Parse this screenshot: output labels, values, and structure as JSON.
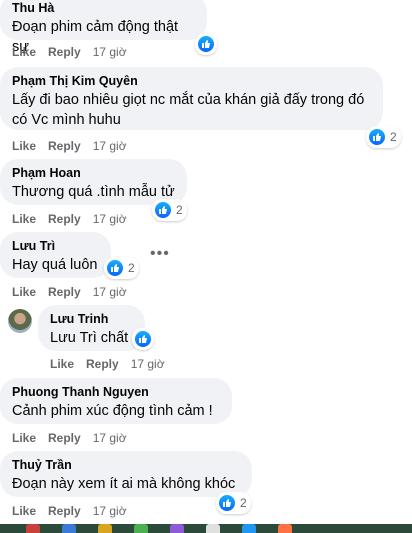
{
  "comments": [
    {
      "author": "Thu Hà",
      "text": "Đoạn phim cảm động thật sự",
      "reactions": ""
    },
    {
      "author": "Phạm Thị Kim Quyên",
      "text": "Lấy đi bao nhiêu giọt nc mắt của khán giả đấy trong đó có Vc mình huhu",
      "reactions": "2"
    },
    {
      "author": "Phạm Hoan",
      "text": "Thương quá .tình mẫu tử",
      "reactions": "2"
    },
    {
      "author": "Lưu Trì",
      "text": "Hay quá luôn",
      "reactions": "2"
    },
    {
      "author": "Lưu Trinh",
      "text": "Lưu Trì chất",
      "reactions": ""
    },
    {
      "author": "Phuong Thanh Nguyen",
      "text": "Cảnh phim xúc động tình cảm !",
      "reactions": ""
    },
    {
      "author": "Thuỷ Trần",
      "text": "Đoạn này xem ít ai mà không khóc",
      "reactions": "2"
    }
  ],
  "actions": {
    "like": "Like",
    "reply": "Reply",
    "time": "17 giờ"
  },
  "more_label": "•••",
  "icons": {
    "reaction": "like-icon",
    "menu": "more-options-icon"
  },
  "colors": {
    "bubble": "#f0f2f5",
    "like_blue": "#0866ff",
    "meta_gray": "#65676b"
  }
}
